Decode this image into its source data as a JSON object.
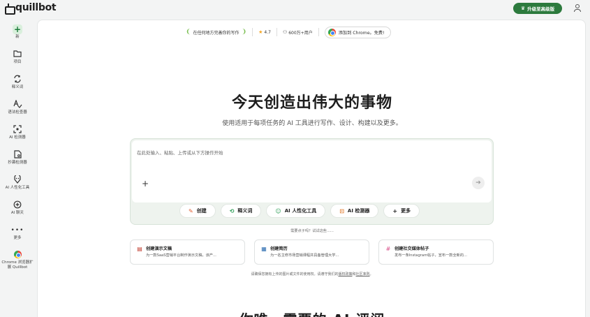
{
  "brand": {
    "name": "quillbot"
  },
  "header": {
    "upgrade_label": "升级至高级版"
  },
  "sidebar": {
    "items": [
      {
        "label": "新",
        "icon": "plus-icon"
      },
      {
        "label": "项目",
        "icon": "folder-icon"
      },
      {
        "label": "释义词",
        "icon": "paraphrase-icon"
      },
      {
        "label": "语法检查器",
        "icon": "grammar-icon"
      },
      {
        "label": "AI 检测器",
        "icon": "ai-detector-icon"
      },
      {
        "label": "抄袭检测器",
        "icon": "plagiarism-icon"
      },
      {
        "label": "AI 人性化工具",
        "icon": "humanizer-icon"
      },
      {
        "label": "AI 聊天",
        "icon": "chat-icon"
      },
      {
        "label": "更多",
        "icon": "more-icon"
      },
      {
        "label": "Chrome 浏览器扩展 Quillbot",
        "icon": "chrome-icon"
      }
    ]
  },
  "promo": {
    "award": "在任何地方完善你的写作",
    "rating": "4.7",
    "users": "600万+用户",
    "chrome_cta": "添加到 Chrome。免费!"
  },
  "hero": {
    "title": "今天创造出伟大的事物",
    "subtitle": "使用适用于每项任务的 AI 工具进行写作、设计、构建以及更多。"
  },
  "composer": {
    "placeholder": "在此处输入、粘贴、上传或从下方操作开始",
    "actions": [
      {
        "label": "创建",
        "icon": "create-icon",
        "color": "#e0592a"
      },
      {
        "label": "释义词",
        "icon": "paraphrase-icon",
        "color": "#2e9e57"
      },
      {
        "label": "AI 人性化工具",
        "icon": "humanizer-icon",
        "color": "#2e9e57"
      },
      {
        "label": "AI 检测器",
        "icon": "ai-detector-icon",
        "color": "#e07a2a"
      },
      {
        "label": "更多",
        "icon": "plus-icon",
        "color": "#222222"
      }
    ]
  },
  "hint": "需要点子吗？试试这些......",
  "suggestions": [
    {
      "title": "创建演示文稿",
      "desc": "为一款SaaS营销平台制作演示文稿，该产...",
      "icon": "presentation-icon",
      "color": "#c0392b"
    },
    {
      "title": "创建简历",
      "desc": "为一名主修市场营销课程并具备管理大学...",
      "icon": "resume-icon",
      "color": "#2b6cb0"
    },
    {
      "title": "创建社交媒体帖子",
      "desc": "发布一条Instagram帖子，宣布一款全新的...",
      "icon": "hashtag-icon",
      "color": "#d94f8a"
    }
  ],
  "legal": {
    "prefix": "请确保您拥有上传的图片或文件的使用权。请遵守我们的",
    "link1": "版权政策",
    "and": "和",
    "link2": "社区准则",
    "suffix": "。"
  },
  "bottom_heading": "你唯一需要的 AI 评阅"
}
